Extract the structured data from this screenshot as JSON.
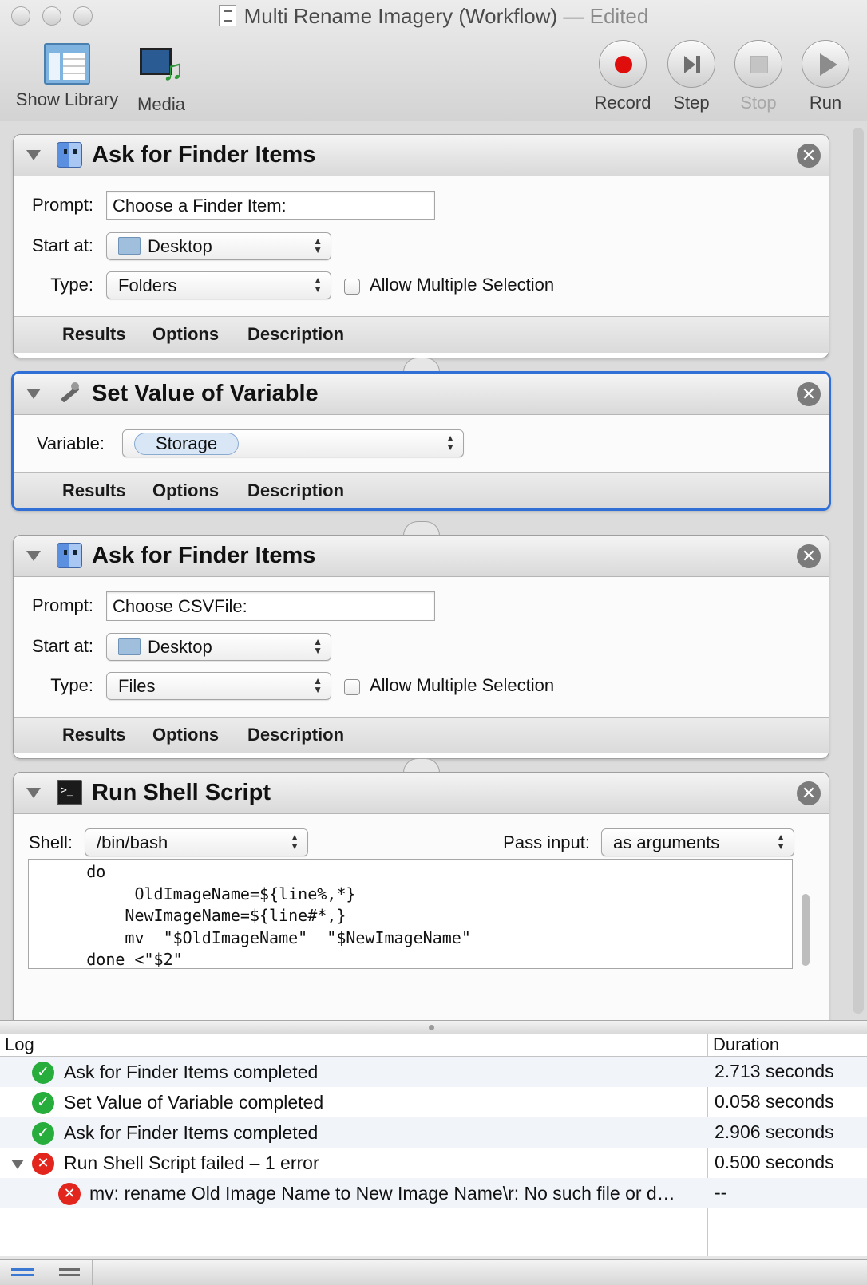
{
  "window": {
    "title": "Multi Rename Imagery (Workflow)",
    "edited": "— Edited"
  },
  "toolbar": {
    "show_library": "Show Library",
    "media": "Media",
    "record": "Record",
    "step": "Step",
    "stop": "Stop",
    "run": "Run"
  },
  "actions": [
    {
      "title": "Ask for Finder Items",
      "prompt_label": "Prompt:",
      "prompt_value": "Choose a Finder Item:",
      "start_label": "Start at:",
      "start_value": "Desktop",
      "type_label": "Type:",
      "type_value": "Folders",
      "multi_label": "Allow Multiple Selection",
      "footer": [
        "Results",
        "Options",
        "Description"
      ]
    },
    {
      "title": "Set Value of Variable",
      "variable_label": "Variable:",
      "variable_value": "Storage",
      "footer": [
        "Results",
        "Options",
        "Description"
      ]
    },
    {
      "title": "Ask for Finder Items",
      "prompt_label": "Prompt:",
      "prompt_value": "Choose CSVFile:",
      "start_label": "Start at:",
      "start_value": "Desktop",
      "type_label": "Type:",
      "type_value": "Files",
      "multi_label": "Allow Multiple Selection",
      "footer": [
        "Results",
        "Options",
        "Description"
      ]
    },
    {
      "title": "Run Shell Script",
      "shell_label": "Shell:",
      "shell_value": "/bin/bash",
      "pass_label": "Pass input:",
      "pass_value": "as arguments",
      "script": "      do\n           OldImageName=${line%,*}\n          NewImageName=${line#*,}\n          mv  \"$OldImageName\"  \"$NewImageName\"\n      done <\"$2\""
    }
  ],
  "log": {
    "col_log": "Log",
    "col_duration": "Duration",
    "rows": [
      {
        "status": "ok",
        "message": "Ask for Finder Items completed",
        "duration": "2.713 seconds"
      },
      {
        "status": "ok",
        "message": "Set Value of Variable completed",
        "duration": "0.058 seconds"
      },
      {
        "status": "ok",
        "message": "Ask for Finder Items completed",
        "duration": "2.906 seconds"
      },
      {
        "status": "error",
        "message": "Run Shell Script failed – 1 error",
        "duration": "0.500 seconds"
      },
      {
        "status": "error",
        "message": "mv: rename Old Image Name to New Image Name\\r: No such file or d…",
        "duration": "--"
      }
    ]
  },
  "icons": {
    "ok": "✓",
    "error": "✕",
    "close": "✕",
    "popup_arrows": "▲▼"
  },
  "colors": {
    "selection_blue": "#2f6fd6",
    "record_red": "#e00d0d",
    "ok_green": "#27ad3c",
    "error_red": "#e2261e"
  }
}
